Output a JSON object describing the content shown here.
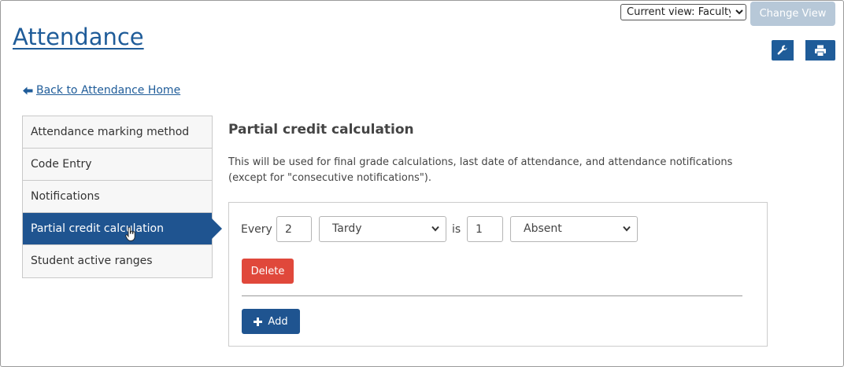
{
  "header": {
    "view_selected": "Current view: Faculty",
    "change_view_label": "Change View",
    "page_title": "Attendance"
  },
  "nav": {
    "back_label": "Back to Attendance Home"
  },
  "sidebar": {
    "items": [
      {
        "label": "Attendance marking method"
      },
      {
        "label": "Code Entry"
      },
      {
        "label": "Notifications"
      },
      {
        "label": "Partial credit calculation",
        "active": true
      },
      {
        "label": "Student active ranges"
      }
    ]
  },
  "content": {
    "title": "Partial credit calculation",
    "description": "This will be used for final grade calculations, last date of attendance, and attendance notifications (except for \"consecutive notifications\").",
    "rule": {
      "every_label": "Every",
      "count_value": "2",
      "code_selected": "Tardy",
      "is_label": "is",
      "equals_value": "1",
      "result_selected": "Absent"
    },
    "delete_label": "Delete",
    "add_label": "Add"
  },
  "colors": {
    "primary": "#1f5490",
    "link": "#1f5c99",
    "danger": "#e0483b",
    "disabled": "#b7c8d8"
  },
  "icons": {
    "tools": "wrench-icon",
    "print": "printer-icon",
    "back": "arrow-left-icon",
    "add": "plus-icon",
    "select": "chevron-down-icon"
  }
}
